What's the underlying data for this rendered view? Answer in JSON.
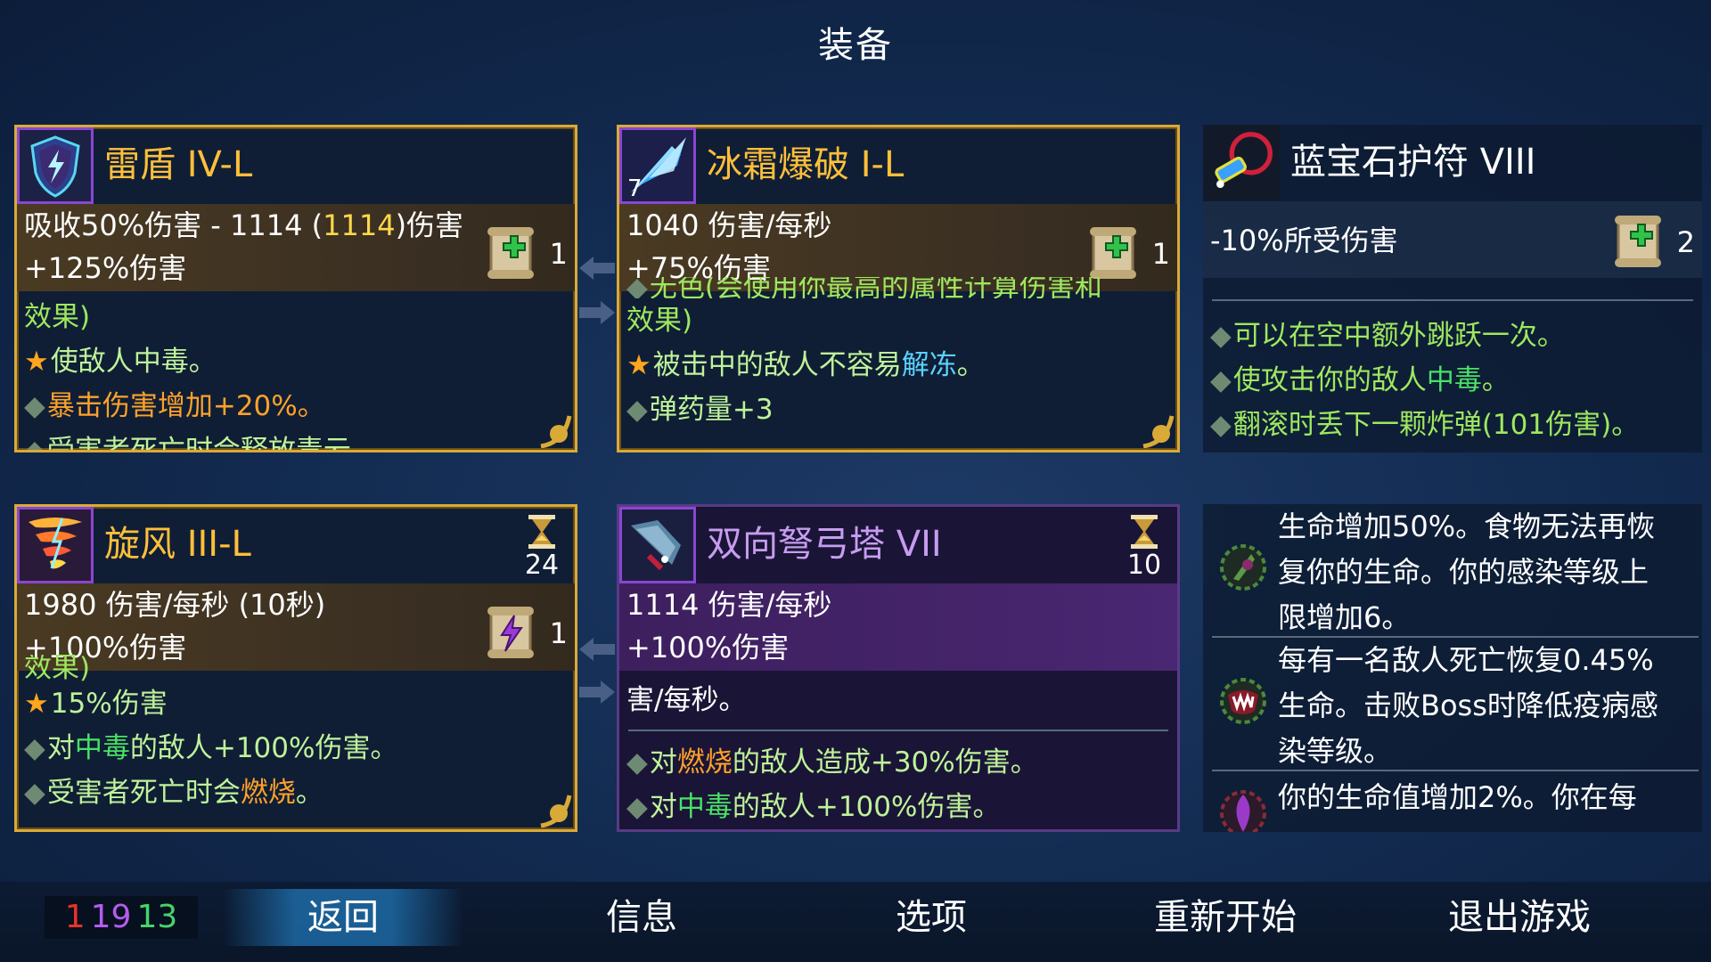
{
  "title": "装备",
  "cards": {
    "thunder_shield": {
      "name": "雷盾 IV-L",
      "stat1_pre": "吸收50%伤害 - 1114 (",
      "stat1_hl": "1114",
      "stat1_post": ")伤害",
      "stat2": "+125%伤害",
      "scroll_count": "1",
      "effect_top": "效果)",
      "effect1": "使敌人中毒。",
      "effect2": "暴击伤害增加+20%。",
      "effect3_partial": "受害者死亡时会释放毒云"
    },
    "frost_blast": {
      "name": "冰霜爆破 I-L",
      "icon_number": "7",
      "stat1": "1040 伤害/每秒",
      "stat2": "+75%伤害",
      "scroll_count": "1",
      "effect_partial": "无色(会使用你最高的属性计算伤害和",
      "effect_top": "效果)",
      "effect1_pre": "被击中的敌人不容易",
      "effect1_hl": "解冻",
      "effect1_post": "。",
      "effect2": "弹药量+3"
    },
    "sapphire_amulet": {
      "name": "蓝宝石护符 VIII",
      "stat1": "-10%所受伤害",
      "scroll_count": "2",
      "effect1": "可以在空中额外跳跃一次。",
      "effect2_pre": "使攻击你的敌人",
      "effect2_hl": "中毒",
      "effect2_post": "。",
      "effect3": "翻滚时丢下一颗炸弹(101伤害)。"
    },
    "tornado": {
      "name": "旋风 III-L",
      "cooldown": "24",
      "stat1": "1980 伤害/每秒 (10秒)",
      "stat2": "+100%伤害",
      "scroll_count": "1",
      "effect_top": "效果)",
      "effect1": "15%伤害",
      "effect2_pre": "对",
      "effect2_hl": "中毒",
      "effect2_post": "的敌人+100%伤害。",
      "effect3_pre": "受害者死亡时会",
      "effect3_hl": "燃烧",
      "effect3_post": "。"
    },
    "double_crossbow": {
      "name": "双向弩弓塔 VII",
      "cooldown": "10",
      "stat1": "1114 伤害/每秒",
      "stat2": "+100%伤害",
      "effect_top": "害/每秒。",
      "effect1_pre": "对",
      "effect1_hl": "燃烧",
      "effect1_post": "的敌人造成+30%伤害。",
      "effect2_pre": "对",
      "effect2_hl": "中毒",
      "effect2_post": "的敌人+100%伤害。"
    }
  },
  "mutations": [
    {
      "line1": "生命增加50%。食物无法再恢",
      "line2": "复你的生命。你的感染等级上",
      "line3": "限增加6。"
    },
    {
      "line1": "每有一名敌人死亡恢复0.45%",
      "line2": "生命。击败Boss时降低疫病感",
      "line3": "染等级。"
    },
    {
      "line1": "你的生命值增加2%。你在每"
    }
  ],
  "bottom": {
    "counters": [
      "1",
      "19",
      "13"
    ],
    "counter_colors": [
      "#e8322c",
      "#b45cf0",
      "#47d36a"
    ],
    "menu": [
      "返回",
      "信息",
      "选项",
      "重新开始",
      "退出游戏"
    ]
  },
  "colors": {
    "gold_border": "#d9aa38",
    "gold_text": "#ffbf3a",
    "purple_text": "#c79cf0",
    "effect_green": "#9ee85f",
    "poison_green": "#49e267",
    "fire_orange": "#ffa22a",
    "freeze_cyan": "#5ad2ff"
  }
}
